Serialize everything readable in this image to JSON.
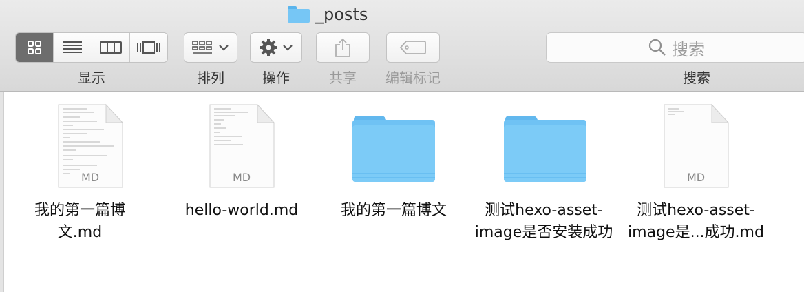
{
  "window": {
    "title": "_posts"
  },
  "toolbar": {
    "view_label": "显示",
    "arrange_label": "排列",
    "action_label": "操作",
    "share_label": "共享",
    "tags_label": "编辑标记",
    "search_label": "搜索",
    "search_placeholder": "搜索"
  },
  "files": [
    {
      "name_line1": "我的第一篇博",
      "name_line2": "文.md",
      "kind": "md-file",
      "badge": "MD"
    },
    {
      "name_line1": "hello-world.md",
      "name_line2": "",
      "kind": "md-file",
      "badge": "MD"
    },
    {
      "name_line1": "我的第一篇博文",
      "name_line2": "",
      "kind": "folder"
    },
    {
      "name_line1": "测试hexo-asset-",
      "name_line2": "image是否安装成功",
      "kind": "folder"
    },
    {
      "name_line1": "测试hexo-asset-",
      "name_line2": "image是...成功.md",
      "kind": "md-file",
      "badge": "MD"
    }
  ],
  "colors": {
    "folder": "#7ccbf7",
    "folder_tab": "#62b8ee",
    "active_segment": "#6d6d6d"
  }
}
